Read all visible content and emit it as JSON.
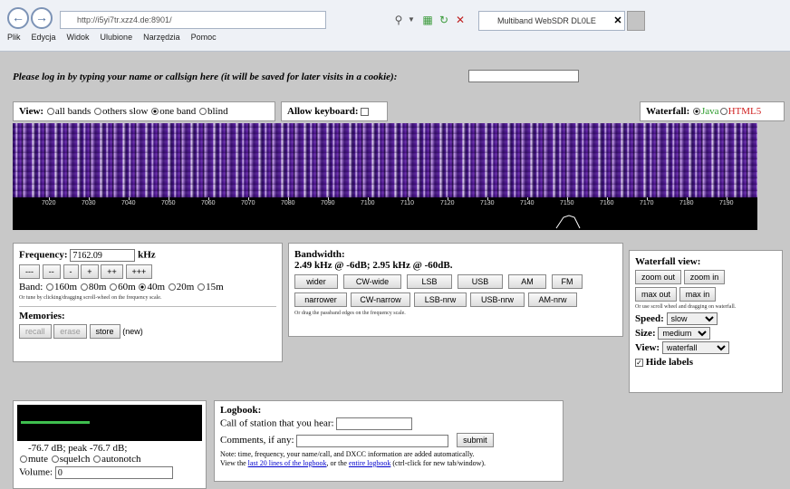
{
  "browser": {
    "url": "http://i5yi7tr.xzz4.de:8901/",
    "tab_title": "Multiband WebSDR DL0LE",
    "menu": [
      "Plik",
      "Edycja",
      "Widok",
      "Ulubione",
      "Narzędzia",
      "Pomoc"
    ]
  },
  "login": {
    "prompt": "Please log in by typing your name or callsign here (it will be saved for later visits in a cookie):",
    "value": ""
  },
  "view": {
    "label": "View:",
    "options": [
      "all bands",
      "others slow",
      "one band",
      "blind"
    ],
    "selected": 2,
    "keyboard_label": "Allow keyboard:"
  },
  "waterfall_mode": {
    "label": "Waterfall:",
    "java": "Java",
    "html5": "HTML5",
    "selected": "java",
    "java_color": "#2a9a2a",
    "html5_color": "#d02020"
  },
  "scale": {
    "ticks": [
      "7020",
      "7030",
      "7040",
      "7050",
      "7060",
      "7070",
      "7080",
      "7090",
      "7100",
      "7110",
      "7120",
      "7130",
      "7140",
      "7150",
      "7160",
      "7170",
      "7180",
      "7190"
    ]
  },
  "frequency": {
    "label": "Frequency:",
    "value": "7162.09",
    "unit": "kHz",
    "step_buttons": [
      "---",
      "--",
      "-",
      "+",
      "++",
      "+++"
    ],
    "band_label": "Band:",
    "bands": [
      "160m",
      "80m",
      "60m",
      "40m",
      "20m",
      "15m"
    ],
    "band_selected": 3,
    "hint": "Or tune by clicking/dragging scroll-wheel on the frequency scale."
  },
  "memories": {
    "label": "Memories:",
    "buttons": [
      "recall",
      "erase",
      "store"
    ],
    "status": "(new)"
  },
  "bandwidth": {
    "label": "Bandwidth:",
    "value_text": "2.49 kHz @ -6dB; 2.95 kHz @ -60dB.",
    "row1": [
      "wider",
      "CW-wide",
      "LSB",
      "USB",
      "AM",
      "FM"
    ],
    "row2": [
      "narrower",
      "CW-narrow",
      "LSB-nrw",
      "USB-nrw",
      "AM-nrw"
    ],
    "hint": "Or drag the passband edges on the frequency scale."
  },
  "wf_view": {
    "label": "Waterfall view:",
    "buttons": [
      "zoom out",
      "zoom in",
      "max out",
      "max in"
    ],
    "hint": "Or use scroll wheel and dragging on waterfall.",
    "speed_label": "Speed:",
    "speed_value": "slow",
    "size_label": "Size:",
    "size_value": "medium",
    "view_label": "View:",
    "view_value": "waterfall",
    "hide_labels": "Hide labels"
  },
  "smeter": {
    "readout": "-76.7 dB; peak -76.7 dB;",
    "options": [
      "mute",
      "squelch",
      "autonotch"
    ],
    "volume_label": "Volume:",
    "volume_value": "0",
    "bar_level": 0.38,
    "bar_color": "#3fbf4f"
  },
  "logbook": {
    "label": "Logbook:",
    "call_label": "Call of station that you hear:",
    "comments_label": "Comments, if any:",
    "submit": "submit",
    "note": "Note: time, frequency, your name/call, and DXCC information are added automatically.",
    "view_prefix": "View the",
    "link1": "last 20 lines of the logbook",
    "mid": ", or the",
    "link2": "entire logbook",
    "suffix": "(ctrl-click for new tab/window)."
  }
}
